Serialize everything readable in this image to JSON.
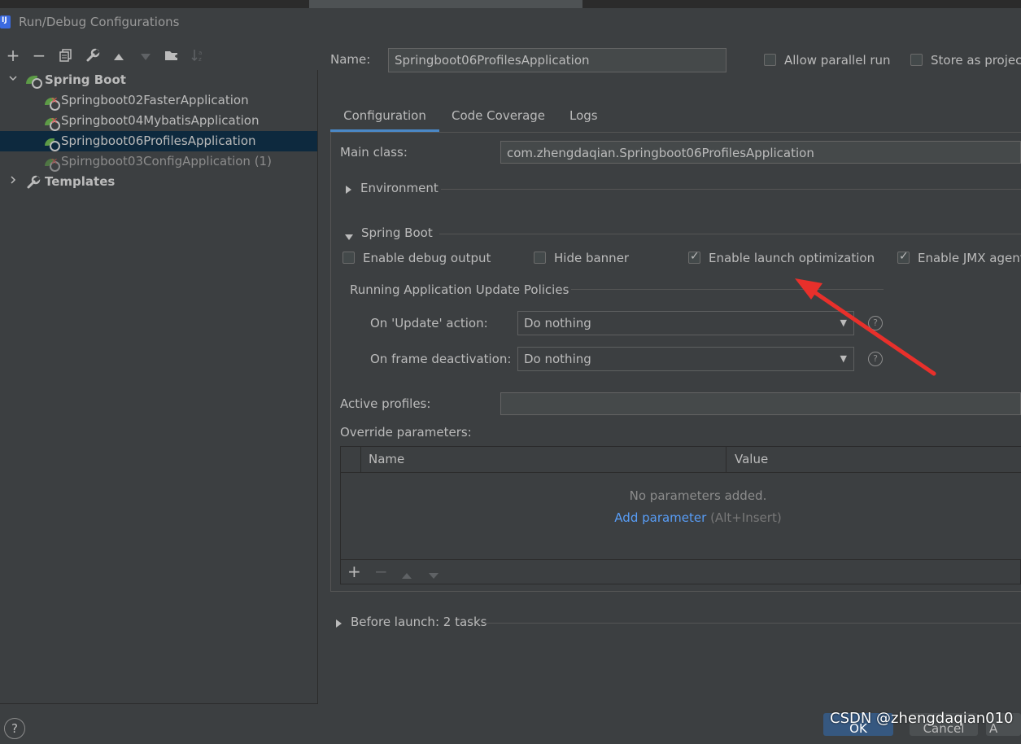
{
  "window": {
    "title": "Run/Debug Configurations"
  },
  "toolbar": {
    "add_icon": "plus-icon",
    "remove_icon": "minus-icon",
    "copy_icon": "copy-icon",
    "edit_defaults_icon": "wrench-icon",
    "move_up_icon": "triangle-up-icon",
    "move_down_icon": "triangle-down-icon",
    "new_folder_icon": "folder-icon",
    "sort_icon": "sort-icon"
  },
  "tree": {
    "group_label": "Spring Boot",
    "items": [
      {
        "label": "Springboot02FasterApplication",
        "error": true,
        "selected": false,
        "dim": false
      },
      {
        "label": "Springboot04MybatisApplication",
        "error": true,
        "selected": false,
        "dim": false
      },
      {
        "label": "Springboot06ProfilesApplication",
        "error": false,
        "selected": true,
        "dim": false
      },
      {
        "label": "Spirngboot03ConfigApplication (1)",
        "error": true,
        "selected": false,
        "dim": true
      }
    ],
    "templates_label": "Templates"
  },
  "header": {
    "name_label": "Name:",
    "name_value": "Springboot06ProfilesApplication",
    "allow_parallel_label": "Allow parallel run",
    "allow_parallel_checked": false,
    "store_as_project_label": "Store as projec",
    "store_as_project_checked": false
  },
  "tabs": [
    {
      "label": "Configuration",
      "active": true
    },
    {
      "label": "Code Coverage",
      "active": false
    },
    {
      "label": "Logs",
      "active": false
    }
  ],
  "config": {
    "main_class_label": "Main class:",
    "main_class_value": "com.zhengdaqian.Springboot06ProfilesApplication",
    "environment_label": "Environment",
    "spring_boot_label": "Spring Boot",
    "checkboxes": [
      {
        "label": "Enable debug output",
        "checked": false
      },
      {
        "label": "Hide banner",
        "checked": false
      },
      {
        "label": "Enable launch optimization",
        "checked": true
      },
      {
        "label": "Enable JMX agent",
        "checked": true
      }
    ],
    "policies_title": "Running Application Update Policies",
    "update_action_label": "On 'Update' action:",
    "update_action_value": "Do nothing",
    "frame_deactivation_label": "On frame deactivation:",
    "frame_deactivation_value": "Do nothing",
    "active_profiles_label": "Active profiles:",
    "active_profiles_value": "",
    "override_params_label": "Override parameters:",
    "table": {
      "columns": [
        "Name",
        "Value"
      ],
      "empty_text": "No parameters added.",
      "add_link": "Add parameter",
      "add_hint": "(Alt+Insert)"
    }
  },
  "before_launch_label": "Before launch: 2 tasks",
  "footer": {
    "help_label": "?",
    "ok_label": "OK",
    "cancel_label": "Cancel",
    "apply_label": "A"
  },
  "watermark": "CSDN @zhengdaqian010",
  "colors": {
    "background": "#3c3f41",
    "selection": "#0d293e",
    "accent": "#4a88c7",
    "link": "#589df6",
    "annotation_arrow": "#e8302b"
  }
}
